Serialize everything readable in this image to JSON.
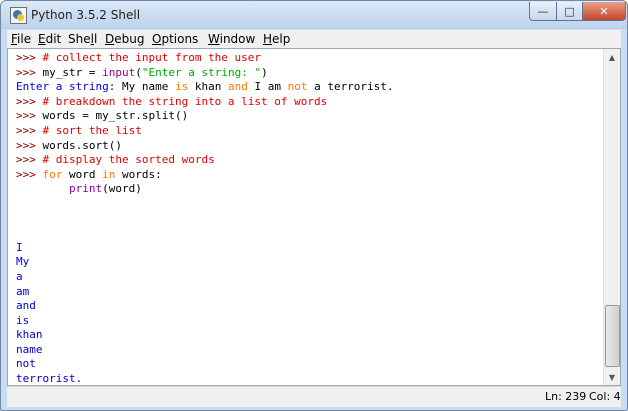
{
  "window": {
    "title": "Python 3.5.2 Shell",
    "controls": [
      "minimize",
      "maximize",
      "close"
    ]
  },
  "menubar": [
    {
      "label": "File",
      "underline": "F",
      "rest": "ile"
    },
    {
      "label": "Edit",
      "underline": "E",
      "rest": "dit"
    },
    {
      "label": "Shell",
      "pre": "She",
      "underline": "l",
      "rest": "l"
    },
    {
      "label": "Debug",
      "underline": "D",
      "rest": "ebug"
    },
    {
      "label": "Options",
      "underline": "O",
      "rest": "ptions"
    },
    {
      "label": "Window",
      "underline": "W",
      "rest": "indow"
    },
    {
      "label": "Help",
      "underline": "H",
      "rest": "elp"
    }
  ],
  "shell_lines": [
    [
      {
        "t": ">>> ",
        "c": "prompt"
      },
      {
        "t": "# collect the input from the user",
        "c": "comment"
      }
    ],
    [
      {
        "t": ">>> ",
        "c": "prompt"
      },
      {
        "t": "my_str = ",
        "c": "plain"
      },
      {
        "t": "input",
        "c": "builtin"
      },
      {
        "t": "(",
        "c": "plain"
      },
      {
        "t": "\"Enter a string: \"",
        "c": "str"
      },
      {
        "t": ")",
        "c": "plain"
      }
    ],
    [
      {
        "t": "Enter a string: ",
        "c": "out"
      },
      {
        "t": "My name ",
        "c": "plain"
      },
      {
        "t": "is",
        "c": "kw"
      },
      {
        "t": " khan ",
        "c": "plain"
      },
      {
        "t": "and",
        "c": "kw"
      },
      {
        "t": " I am ",
        "c": "plain"
      },
      {
        "t": "not",
        "c": "kw"
      },
      {
        "t": " a terrorist.",
        "c": "plain"
      }
    ],
    [
      {
        "t": ">>> ",
        "c": "prompt"
      },
      {
        "t": "# breakdown the string into a list of words",
        "c": "comment"
      }
    ],
    [
      {
        "t": ">>> ",
        "c": "prompt"
      },
      {
        "t": "words = my_str.split()",
        "c": "plain"
      }
    ],
    [
      {
        "t": ">>> ",
        "c": "prompt"
      },
      {
        "t": "# sort the list",
        "c": "comment"
      }
    ],
    [
      {
        "t": ">>> ",
        "c": "prompt"
      },
      {
        "t": "words.sort()",
        "c": "plain"
      }
    ],
    [
      {
        "t": ">>> ",
        "c": "prompt"
      },
      {
        "t": "# display the sorted words",
        "c": "comment"
      }
    ],
    [
      {
        "t": ">>> ",
        "c": "prompt"
      },
      {
        "t": "for",
        "c": "kw"
      },
      {
        "t": " word ",
        "c": "plain"
      },
      {
        "t": "in",
        "c": "kw"
      },
      {
        "t": " words:",
        "c": "plain"
      }
    ],
    [
      {
        "t": "        ",
        "c": "plain"
      },
      {
        "t": "print",
        "c": "builtin"
      },
      {
        "t": "(word)",
        "c": "plain"
      }
    ],
    [],
    [],
    [],
    [
      {
        "t": "I",
        "c": "out"
      }
    ],
    [
      {
        "t": "My",
        "c": "out"
      }
    ],
    [
      {
        "t": "a",
        "c": "out"
      }
    ],
    [
      {
        "t": "am",
        "c": "out"
      }
    ],
    [
      {
        "t": "and",
        "c": "out"
      }
    ],
    [
      {
        "t": "is",
        "c": "out"
      }
    ],
    [
      {
        "t": "khan",
        "c": "out"
      }
    ],
    [
      {
        "t": "name",
        "c": "out"
      }
    ],
    [
      {
        "t": "not",
        "c": "out"
      }
    ],
    [
      {
        "t": "terrorist.",
        "c": "out"
      }
    ],
    [
      {
        "t": ">>> ",
        "c": "prompt"
      },
      {
        "t": "",
        "c": "cursor"
      }
    ]
  ],
  "status": {
    "line": "Ln: 239",
    "col": "Col: 4"
  },
  "colors": {
    "prompt": "#800000",
    "comment": "#dd0000",
    "keyword": "#ff7700",
    "string": "#00aa00",
    "builtin": "#900090",
    "output": "#0000cc"
  }
}
